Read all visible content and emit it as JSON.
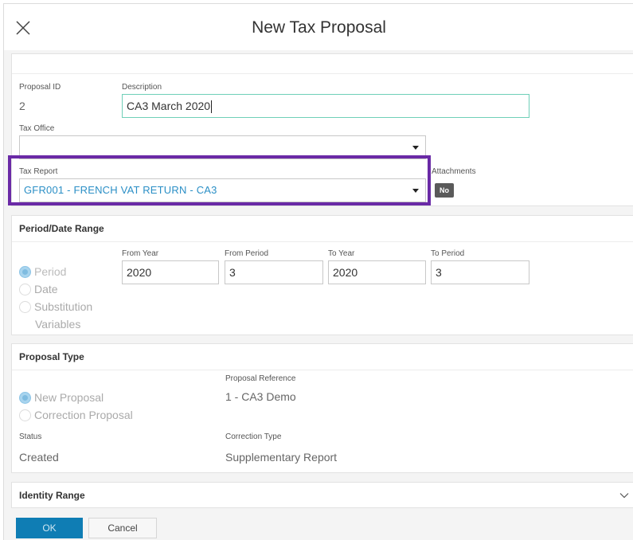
{
  "dialog": {
    "title": "New Tax Proposal"
  },
  "general": {
    "proposal_id_label": "Proposal ID",
    "proposal_id_value": "2",
    "description_label": "Description",
    "description_value": "CA3 March 2020",
    "tax_office_label": "Tax Office",
    "tax_office_value": "",
    "tax_report_label": "Tax Report",
    "tax_report_value": "GFR001 - FRENCH VAT RETURN - CA3",
    "attachments_label": "Attachments",
    "attachments_value": "No"
  },
  "period": {
    "header": "Period/Date Range",
    "options": [
      "Period",
      "Date",
      "Substitution",
      "Variables"
    ],
    "selected": "Period",
    "from_year_label": "From Year",
    "from_year_value": "2020",
    "from_period_label": "From Period",
    "from_period_value": "3",
    "to_year_label": "To Year",
    "to_year_value": "2020",
    "to_period_label": "To Period",
    "to_period_value": "3"
  },
  "proposal_type": {
    "header": "Proposal Type",
    "options": [
      "New Proposal",
      "Correction Proposal"
    ],
    "selected": "New Proposal",
    "reference_label": "Proposal Reference",
    "reference_value": "1 - CA3 Demo",
    "status_label": "Status",
    "status_value": "Created",
    "correction_type_label": "Correction Type",
    "correction_type_value": "Supplementary Report"
  },
  "identity_range": {
    "header": "Identity Range"
  },
  "footer": {
    "ok_label": "OK",
    "cancel_label": "Cancel"
  },
  "colors": {
    "accent": "#0f7db4",
    "highlight": "#6a2aa6",
    "link_text": "#2b8fc6"
  }
}
